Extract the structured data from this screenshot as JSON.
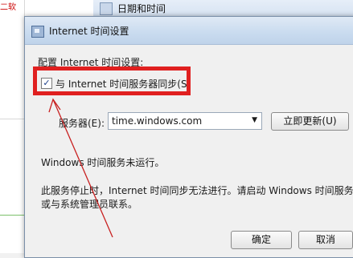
{
  "background": {
    "window_title": "日期和时间",
    "left_strip_text": "二软"
  },
  "dialog": {
    "title": "Internet 时间设置",
    "config_label": "配置 Internet 时间设置:",
    "sync_checkbox": {
      "label": "与 Internet 时间服务器同步(S)",
      "checked": true,
      "mark": "✓"
    },
    "server": {
      "label": "服务器(E):",
      "value": "time.windows.com",
      "arrow": "▼"
    },
    "update_button": "立即更新(U)",
    "status": "Windows 时间服务未运行。",
    "info_line1": "此服务停止时，Internet 时间同步无法进行。请启动 Windows 时间服务",
    "info_line2": "或与系统管理员联系。",
    "ok_button": "确定",
    "cancel_button": "取消"
  },
  "colors": {
    "highlight": "#e02020",
    "titlebar": "#c9dbef",
    "dialog_bg": "#f0f0f0"
  }
}
